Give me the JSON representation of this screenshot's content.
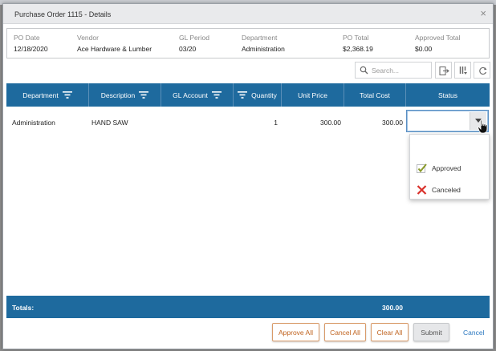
{
  "dialog": {
    "title": "Purchase Order 1115 - Details",
    "close_glyph": "×"
  },
  "summary": {
    "fields": [
      {
        "label": "PO Date",
        "value": "12/18/2020"
      },
      {
        "label": "Vendor",
        "value": "Ace Hardware & Lumber"
      },
      {
        "label": "GL Period",
        "value": "03/20"
      },
      {
        "label": "Department",
        "value": "Administration"
      },
      {
        "label": "PO Total",
        "value": "$2,368.19"
      },
      {
        "label": "Approved Total",
        "value": "$0.00"
      }
    ]
  },
  "toolbar": {
    "search_placeholder": "Search...",
    "icons": [
      "search-icon",
      "export-icon",
      "columns-icon",
      "refresh-icon"
    ]
  },
  "grid": {
    "headers": [
      "Department",
      "Description",
      "GL Account",
      "Quantity",
      "Unit Price",
      "Total Cost",
      "Status"
    ],
    "rows": [
      {
        "department": "Administration",
        "description": "HAND SAW",
        "gl_account": "",
        "quantity": "1",
        "unit_price": "300.00",
        "total_cost": "300.00",
        "status": ""
      }
    ]
  },
  "status_dropdown": {
    "selected": "",
    "options": [
      {
        "label": "",
        "icon": "blank"
      },
      {
        "label": "Approved",
        "icon": "check-icon"
      },
      {
        "label": "Canceled",
        "icon": "x-icon"
      }
    ]
  },
  "totals": {
    "label": "Totals:",
    "total_cost": "300.00"
  },
  "footer": {
    "approve_all": "Approve All",
    "cancel_all": "Cancel All",
    "clear_all": "Clear All",
    "submit": "Submit",
    "cancel": "Cancel"
  },
  "colors": {
    "header_blue": "#1e6a9e",
    "button_orange": "#c0631f",
    "link_blue": "#2b78c0",
    "check_green": "#8a9a2a",
    "cancel_red": "#d9302a"
  }
}
